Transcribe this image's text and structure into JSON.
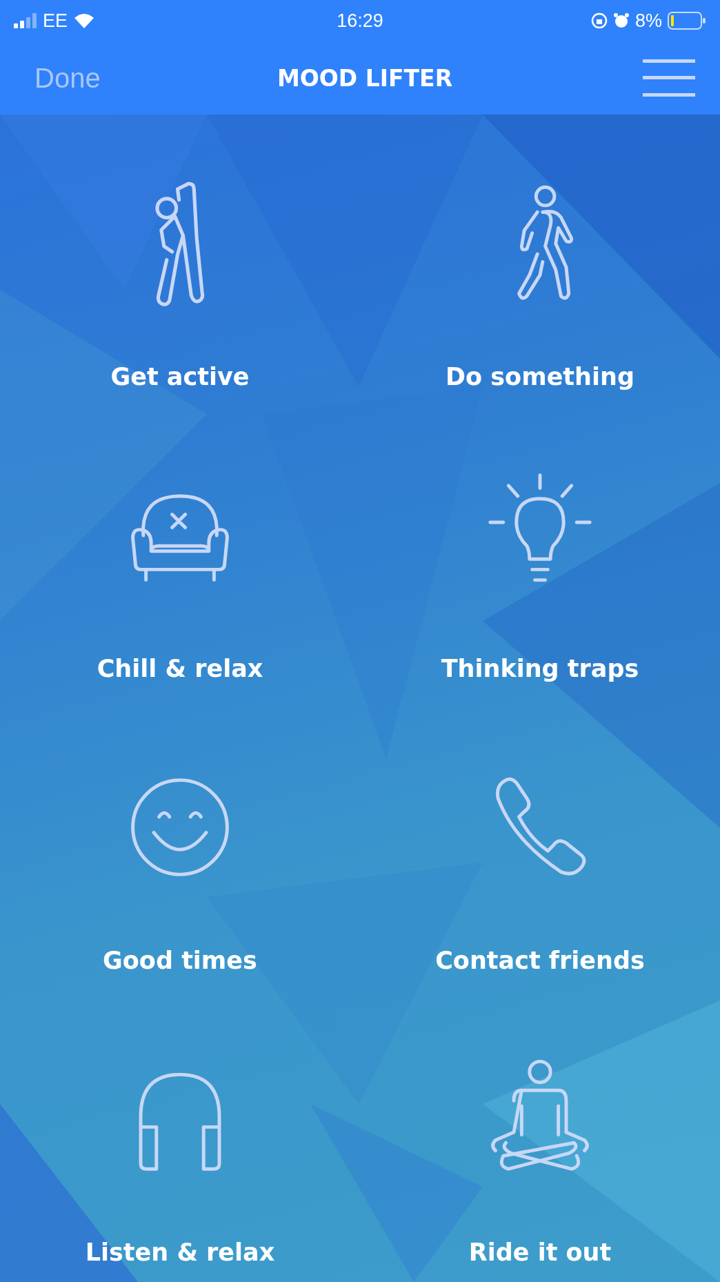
{
  "status_bar": {
    "carrier": "EE",
    "time": "16:29",
    "battery": "8%"
  },
  "nav_bar": {
    "left_button": {
      "label": "Done",
      "disabled": true
    },
    "title": "MOOD LIFTER"
  },
  "tiles": [
    {
      "label": "Get active",
      "kind": "stretch"
    },
    {
      "label": "Do something",
      "kind": "walk"
    },
    {
      "label": "Chill & relax",
      "kind": "armchair"
    },
    {
      "label": "Thinking traps",
      "kind": "bulb"
    },
    {
      "label": "Good times",
      "kind": "smile"
    },
    {
      "label": "Contact friends",
      "kind": "phone"
    },
    {
      "label": "Listen & relax",
      "kind": "headphones"
    },
    {
      "label": "Ride it out",
      "kind": "meditate"
    }
  ]
}
